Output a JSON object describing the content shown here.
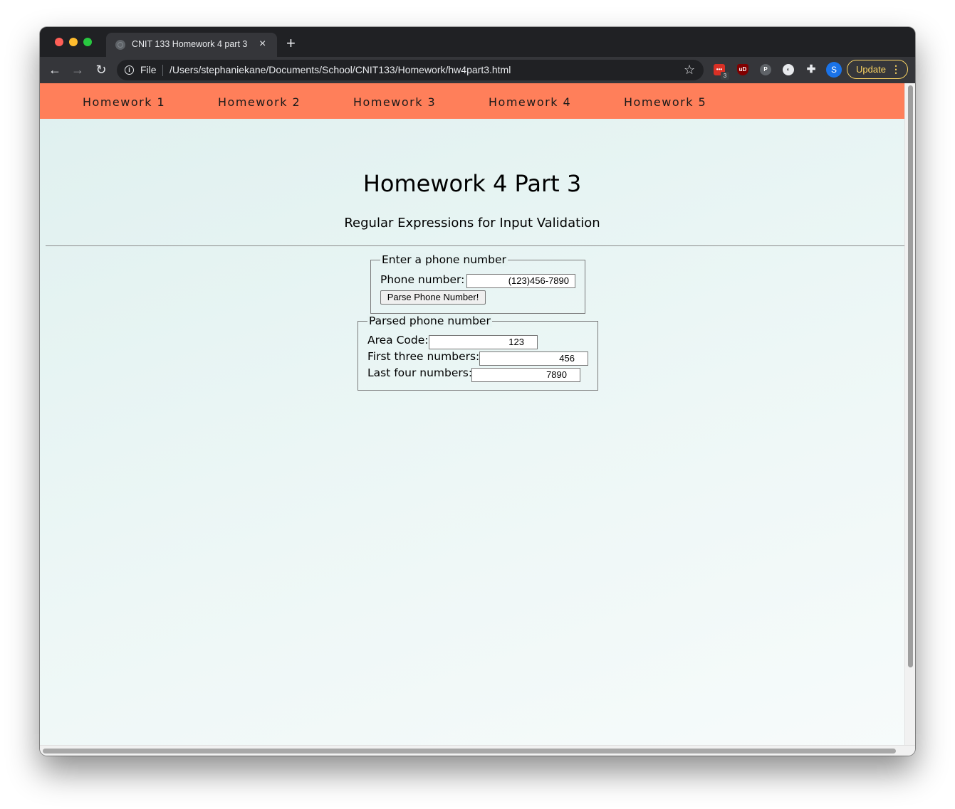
{
  "browser": {
    "tab_title": "CNIT 133 Homework 4 part 3",
    "tab_close": "×",
    "new_tab": "+",
    "nav_back": "←",
    "nav_forward": "→",
    "nav_reload": "↻",
    "file_label": "File",
    "url": "/Users/stephaniekane/Documents/School/CNIT133/Homework/hw4part3.html",
    "bookmark_star": "☆",
    "extension_badge": "3",
    "profile_initial": "S",
    "update_label": "Update",
    "update_menu": "⋮"
  },
  "site_nav": {
    "links": [
      "Homework 1",
      "Homework 2",
      "Homework 3",
      "Homework 4",
      "Homework 5"
    ],
    "background": "#ff7f5a"
  },
  "page": {
    "title": "Homework 4 Part 3",
    "subtitle": "Regular Expressions for Input Validation"
  },
  "phone_form": {
    "legend": "Enter a phone number",
    "label": "Phone number:",
    "value": "(123)456-7890",
    "button_label": "Parse Phone Number!"
  },
  "parsed_form": {
    "legend": "Parsed phone number",
    "area_code_label": "Area Code:",
    "area_code_value": "123",
    "first_three_label": "First three numbers:",
    "first_three_value": "456",
    "last_four_label": "Last four numbers:",
    "last_four_value": "7890"
  }
}
